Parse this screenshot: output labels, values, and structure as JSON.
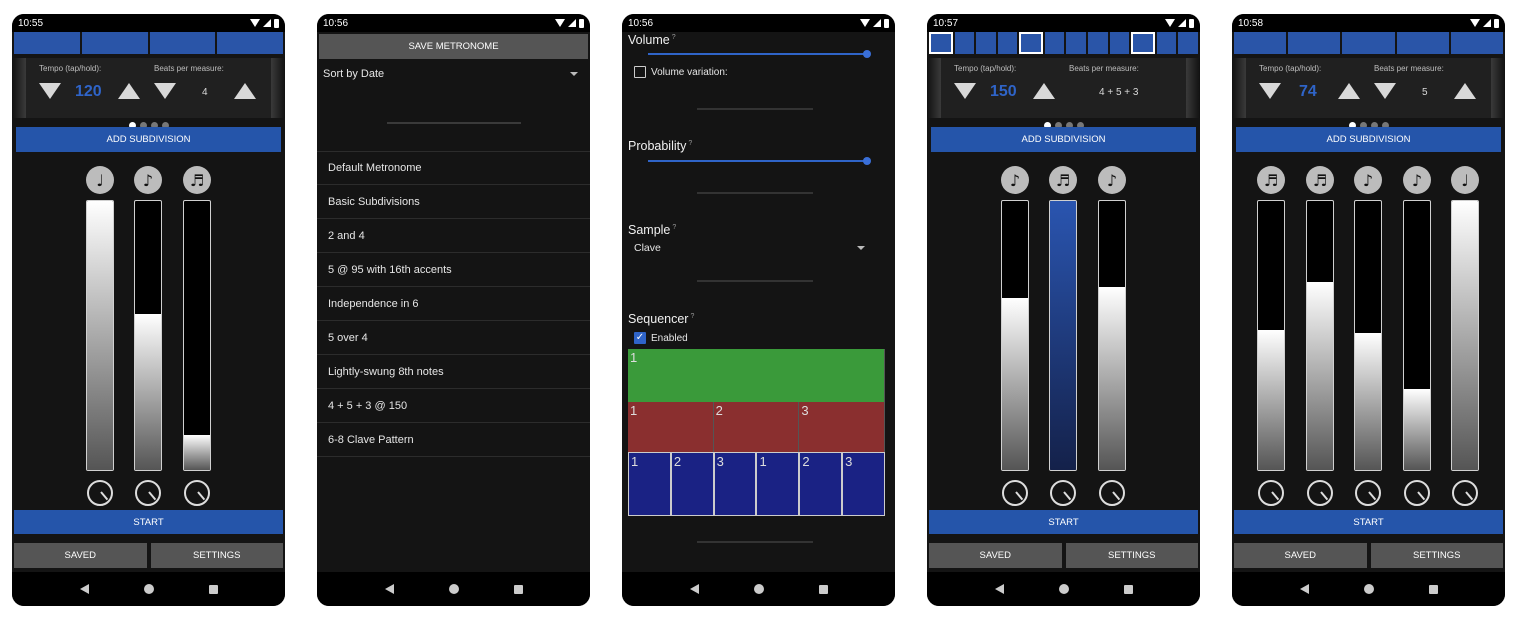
{
  "colors": {
    "accent": "#2555aa",
    "tempo": "#2f64c8",
    "green": "#3a9a3a",
    "red": "#8a2f2f",
    "blue": "#1a2284"
  },
  "labels": {
    "tempo": "Tempo (tap/hold):",
    "beats": "Beats per measure:",
    "add_subdivision": "ADD SUBDIVISION",
    "start": "START",
    "saved": "SAVED",
    "settings": "SETTINGS"
  },
  "phones": [
    {
      "time": "10:55",
      "tempo": "120",
      "beats": "4"
    },
    {
      "time": "10:56"
    },
    {
      "time": "10:56"
    },
    {
      "time": "10:57",
      "tempo": "150",
      "beats": "4 + 5 + 3"
    },
    {
      "time": "10:58",
      "tempo": "74",
      "beats": "5"
    }
  ],
  "phone1": {
    "notes": [
      "♩",
      "♪",
      "♬"
    ],
    "levels": [
      1.0,
      0.58,
      0.13
    ]
  },
  "phone2": {
    "save_label": "SAVE METRONOME",
    "sort_label": "Sort by Date",
    "items": [
      "Default Metronome",
      "Basic Subdivisions",
      "2 and 4",
      "5 @ 95 with 16th accents",
      "Independence in 6",
      "5 over 4",
      "Lightly-swung 8th notes",
      "4 + 5 + 3 @ 150",
      "6-8 Clave Pattern"
    ]
  },
  "phone3": {
    "volume_label": "Volume",
    "volume_variation": "Volume variation:",
    "probability_label": "Probability",
    "sample_label": "Sample",
    "sample_value": "Clave",
    "sequencer_label": "Sequencer",
    "enabled_label": "Enabled",
    "info": "?",
    "row1": [
      "1"
    ],
    "row2": [
      "1",
      "2",
      "3"
    ],
    "row3": [
      "1",
      "2",
      "3",
      "1",
      "2",
      "3"
    ]
  },
  "phone4": {
    "notes": [
      "♪",
      "♬",
      "♪"
    ],
    "levels": [
      0.64,
      1.0,
      0.68
    ]
  },
  "phone5": {
    "notes": [
      "♬",
      "♬",
      "♪",
      "♪",
      "♩"
    ],
    "levels": [
      0.52,
      0.7,
      0.51,
      0.3,
      1.0
    ]
  }
}
